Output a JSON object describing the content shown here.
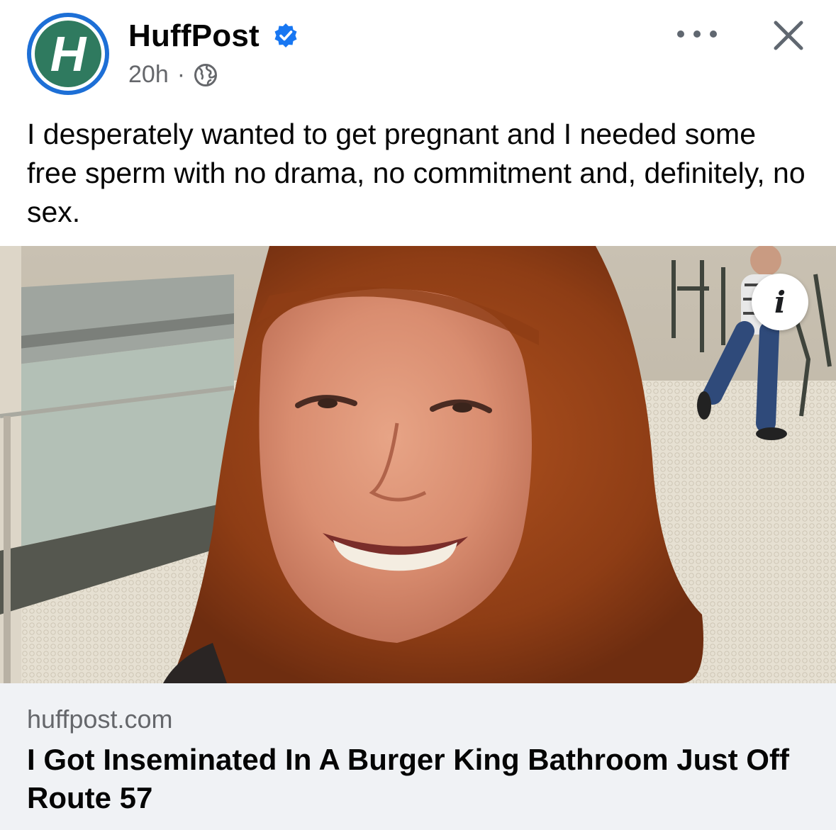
{
  "post": {
    "page_name": "HuffPost",
    "avatar_letter": "H",
    "verified_icon": "verified-badge-icon",
    "timestamp": "20h",
    "separator": "·",
    "audience_icon": "globe-icon",
    "text": "I desperately wanted to get pregnant and I needed some free sperm with no drama, no commitment and, definitely, no sex."
  },
  "actions": {
    "more_icon": "more-options-icon",
    "close_icon": "close-icon",
    "info_label": "i"
  },
  "link": {
    "domain": "huffpost.com",
    "headline": "I Got Inseminated In A Burger King Bathroom Just Off Route 57"
  },
  "colors": {
    "verified_blue": "#1877f2",
    "avatar_ring": "#1d6fd6",
    "avatar_green": "#2f7a5f",
    "secondary_text": "#65676b",
    "preview_bg": "#f0f2f5"
  }
}
